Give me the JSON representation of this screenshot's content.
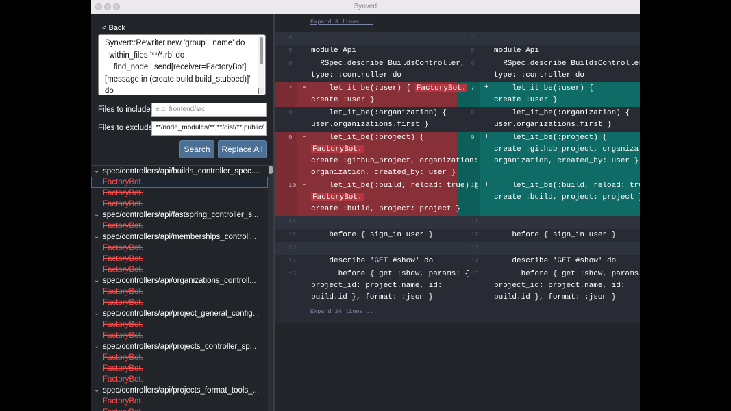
{
  "window": {
    "title": "Synvert"
  },
  "sidebar": {
    "back_label": "< Back",
    "code_lines": [
      "Synvert::Rewriter.new 'group', 'name' do",
      "  within_files '**/*.rb' do",
      "    find_node '.send[receiver=FactoryBot]",
      "[message in (create build build_stubbed)]'",
      "do"
    ],
    "include_label": "Files to include:",
    "include_placeholder": "e.g. frontend/src",
    "exclude_label": "Files to exclude:",
    "exclude_value": "**/node_modules/**,**/dist/**,public/",
    "search_label": "Search",
    "replace_all_label": "Replace All"
  },
  "results": [
    {
      "path": "spec/controllers/api/builds_controller_spec....",
      "matches": [
        "FactoryBot.",
        "FactoryBot.",
        "FactoryBot."
      ]
    },
    {
      "path": "spec/controllers/api/fastspring_controller_s...",
      "matches": [
        "FactoryBot."
      ]
    },
    {
      "path": "spec/controllers/api/memberships_controll...",
      "matches": [
        "FactoryBot.",
        "FactoryBot.",
        "FactoryBot."
      ]
    },
    {
      "path": "spec/controllers/api/organizations_controll...",
      "matches": [
        "FactoryBot.",
        "FactoryBot."
      ]
    },
    {
      "path": "spec/controllers/api/project_general_config...",
      "matches": [
        "FactoryBot.",
        "FactoryBot."
      ]
    },
    {
      "path": "spec/controllers/api/projects_controller_sp...",
      "matches": [
        "FactoryBot.",
        "FactoryBot.",
        "FactoryBot."
      ]
    },
    {
      "path": "spec/controllers/api/projects_format_tools_...",
      "matches": [
        "FactoryBot.",
        "FactoryBot."
      ]
    }
  ],
  "diff": {
    "expand_top": "Expand 3 lines ...",
    "expand_bottom": "Expand 24 lines ...",
    "rows": [
      {
        "kind": "ctx",
        "ln": "4",
        "left": [],
        "right": []
      },
      {
        "kind": "ctx",
        "ln": "5",
        "left": [
          "module Api"
        ],
        "right": [
          "module Api"
        ]
      },
      {
        "kind": "ctx",
        "ln": "6",
        "left": [
          "  RSpec.describe BuildsController,",
          "type: :controller do"
        ],
        "right": [
          "  RSpec.describe BuildsController,",
          "type: :controller do"
        ]
      },
      {
        "kind": "chg",
        "ln": "7",
        "left": [
          "    let_it_be(:user) { |FactoryBot.|",
          "create :user }"
        ],
        "right": [
          "    let_it_be(:user) {",
          "create :user }"
        ]
      },
      {
        "kind": "ctx",
        "ln": "8",
        "left": [
          "    let_it_be(:organization) {",
          "user.organizations.first }"
        ],
        "right": [
          "    let_it_be(:organization) {",
          "user.organizations.first }"
        ]
      },
      {
        "kind": "chg",
        "ln": "9",
        "left": [
          "    let_it_be(:project) {",
          "|FactoryBot.|",
          "create :github_project, organization:",
          "organization, created_by: user }"
        ],
        "right": [
          "    let_it_be(:project) {",
          "create :github_project, organization:",
          "organization, created_by: user }"
        ]
      },
      {
        "kind": "chg",
        "ln": "10",
        "left": [
          "    let_it_be(:build, reload: true) {",
          "|FactoryBot.|",
          "create :build, project: project }"
        ],
        "right": [
          "    let_it_be(:build, reload: true) {",
          "create :build, project: project }"
        ]
      },
      {
        "kind": "ctx",
        "ln": "11",
        "left": [],
        "right": []
      },
      {
        "kind": "ctx",
        "ln": "12",
        "left": [
          "    before { sign_in user }"
        ],
        "right": [
          "    before { sign_in user }"
        ]
      },
      {
        "kind": "ctx",
        "ln": "13",
        "left": [],
        "right": []
      },
      {
        "kind": "ctx",
        "ln": "14",
        "left": [
          "    describe 'GET #show' do"
        ],
        "right": [
          "    describe 'GET #show' do"
        ]
      },
      {
        "kind": "ctx",
        "ln": "15",
        "left": [
          "      before { get :show, params: {",
          "project_id: project.name, id:",
          "build.id }, format: :json }"
        ],
        "right": [
          "      before { get :show, params: {",
          "project_id: project.name, id:",
          "build.id }, format: :json }"
        ]
      }
    ]
  },
  "colors": {
    "deleted_bg": "#873038",
    "deleted_gutter": "#7a2b33",
    "added_bg": "#0f6b66",
    "added_gutter": "#0d5f5a",
    "highlight": "#b5363f",
    "context_bg": "#2f333d",
    "context_bg_dark": "#282b33",
    "match_red": "#ff4d4d"
  }
}
